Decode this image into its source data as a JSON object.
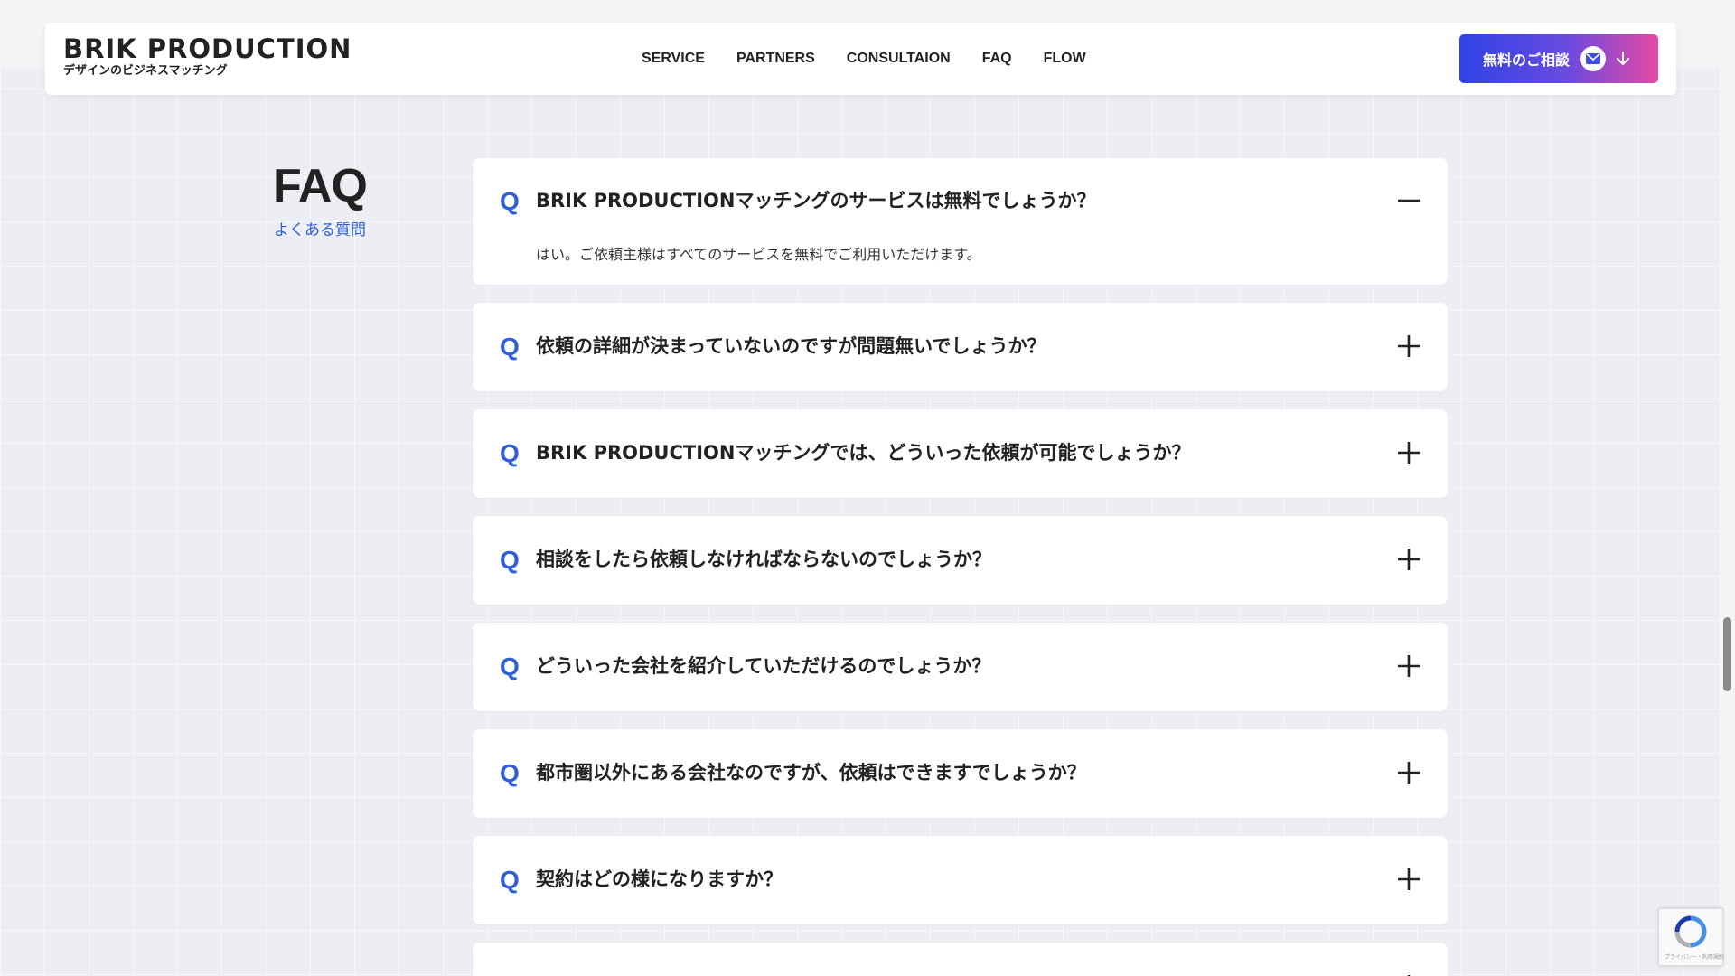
{
  "header": {
    "logo_main": "BRIK PRODUCTION",
    "logo_sub": "デザインのビジネスマッチング",
    "nav": [
      "SERVICE",
      "PARTNERS",
      "CONSULTAION",
      "FAQ",
      "FLOW"
    ],
    "cta_label": "無料のご相談"
  },
  "faq": {
    "title": "FAQ",
    "subtitle": "よくある質問",
    "q_mark": "Q",
    "items": [
      {
        "question": "BRIK PRODUCTIONマッチングのサービスは無料でしょうか？",
        "answer": "はい。ご依頼主様はすべてのサービスを無料でご利用いただけます。",
        "expanded": true
      },
      {
        "question": "依頼の詳細が決まっていないのですが問題無いでしょうか？",
        "expanded": false
      },
      {
        "question": "BRIK PRODUCTIONマッチングでは、どういった依頼が可能でしょうか？",
        "expanded": false
      },
      {
        "question": "相談をしたら依頼しなければならないのでしょうか？",
        "expanded": false
      },
      {
        "question": "どういった会社を紹介していただけるのでしょうか？",
        "expanded": false
      },
      {
        "question": "都市圏以外にある会社なのですが、依頼はできますでしょうか？",
        "expanded": false
      },
      {
        "question": "契約はどの様になりますか？",
        "expanded": false
      }
    ]
  },
  "recaptcha": {
    "text": "プライバシー・利用規約"
  },
  "colors": {
    "accent_blue": "#2f5fd8",
    "cta_gradient_start": "#2f43e6",
    "cta_gradient_end": "#e54aa6",
    "background": "#eceef4"
  }
}
